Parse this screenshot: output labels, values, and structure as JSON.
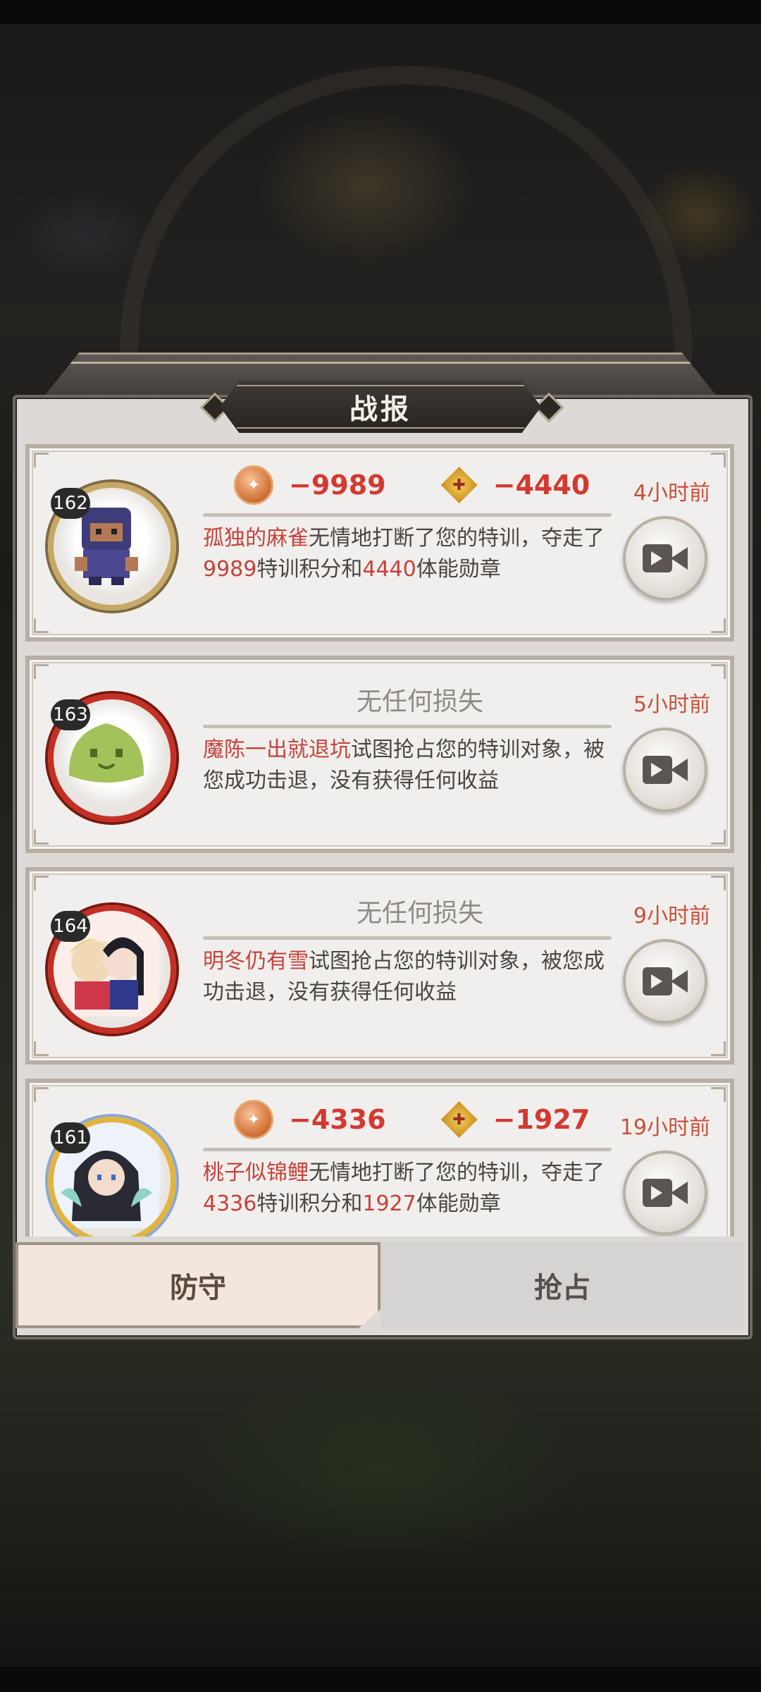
{
  "dialog": {
    "title": "战报"
  },
  "reports": [
    {
      "level": "162",
      "stat1": "−9989",
      "stat2": "−4440",
      "attacker": "孤独的麻雀",
      "text_a": "无情地打断了您的特训，夺走了",
      "num_a": "9989",
      "text_b": "特训积分和",
      "num_b": "4440",
      "text_c": "体能勋章",
      "time": "4小时前"
    },
    {
      "level": "163",
      "result": "无任何损失",
      "attacker": "魔陈一出就退坑",
      "text": "试图抢占您的特训对象，被您成功击退，没有获得任何收益",
      "time": "5小时前"
    },
    {
      "level": "164",
      "result": "无任何损失",
      "attacker": "明冬仍有雪",
      "text": "试图抢占您的特训对象，被您成功击退，没有获得任何收益",
      "time": "9小时前"
    },
    {
      "level": "161",
      "stat1": "−4336",
      "stat2": "−1927",
      "attacker": "桃子似锦鲤",
      "text_a": "无情地打断了您的特训，夺走了",
      "num_a": "4336",
      "text_b": "特训积分和",
      "num_b": "1927",
      "text_c": "体能勋章",
      "time": "19小时前"
    }
  ],
  "tabs": {
    "defend": "防守",
    "attack": "抢占",
    "active": "defend"
  },
  "icons": {
    "points": "training-points-coin-icon",
    "medal": "stamina-medal-icon",
    "replay": "video-replay-icon"
  }
}
